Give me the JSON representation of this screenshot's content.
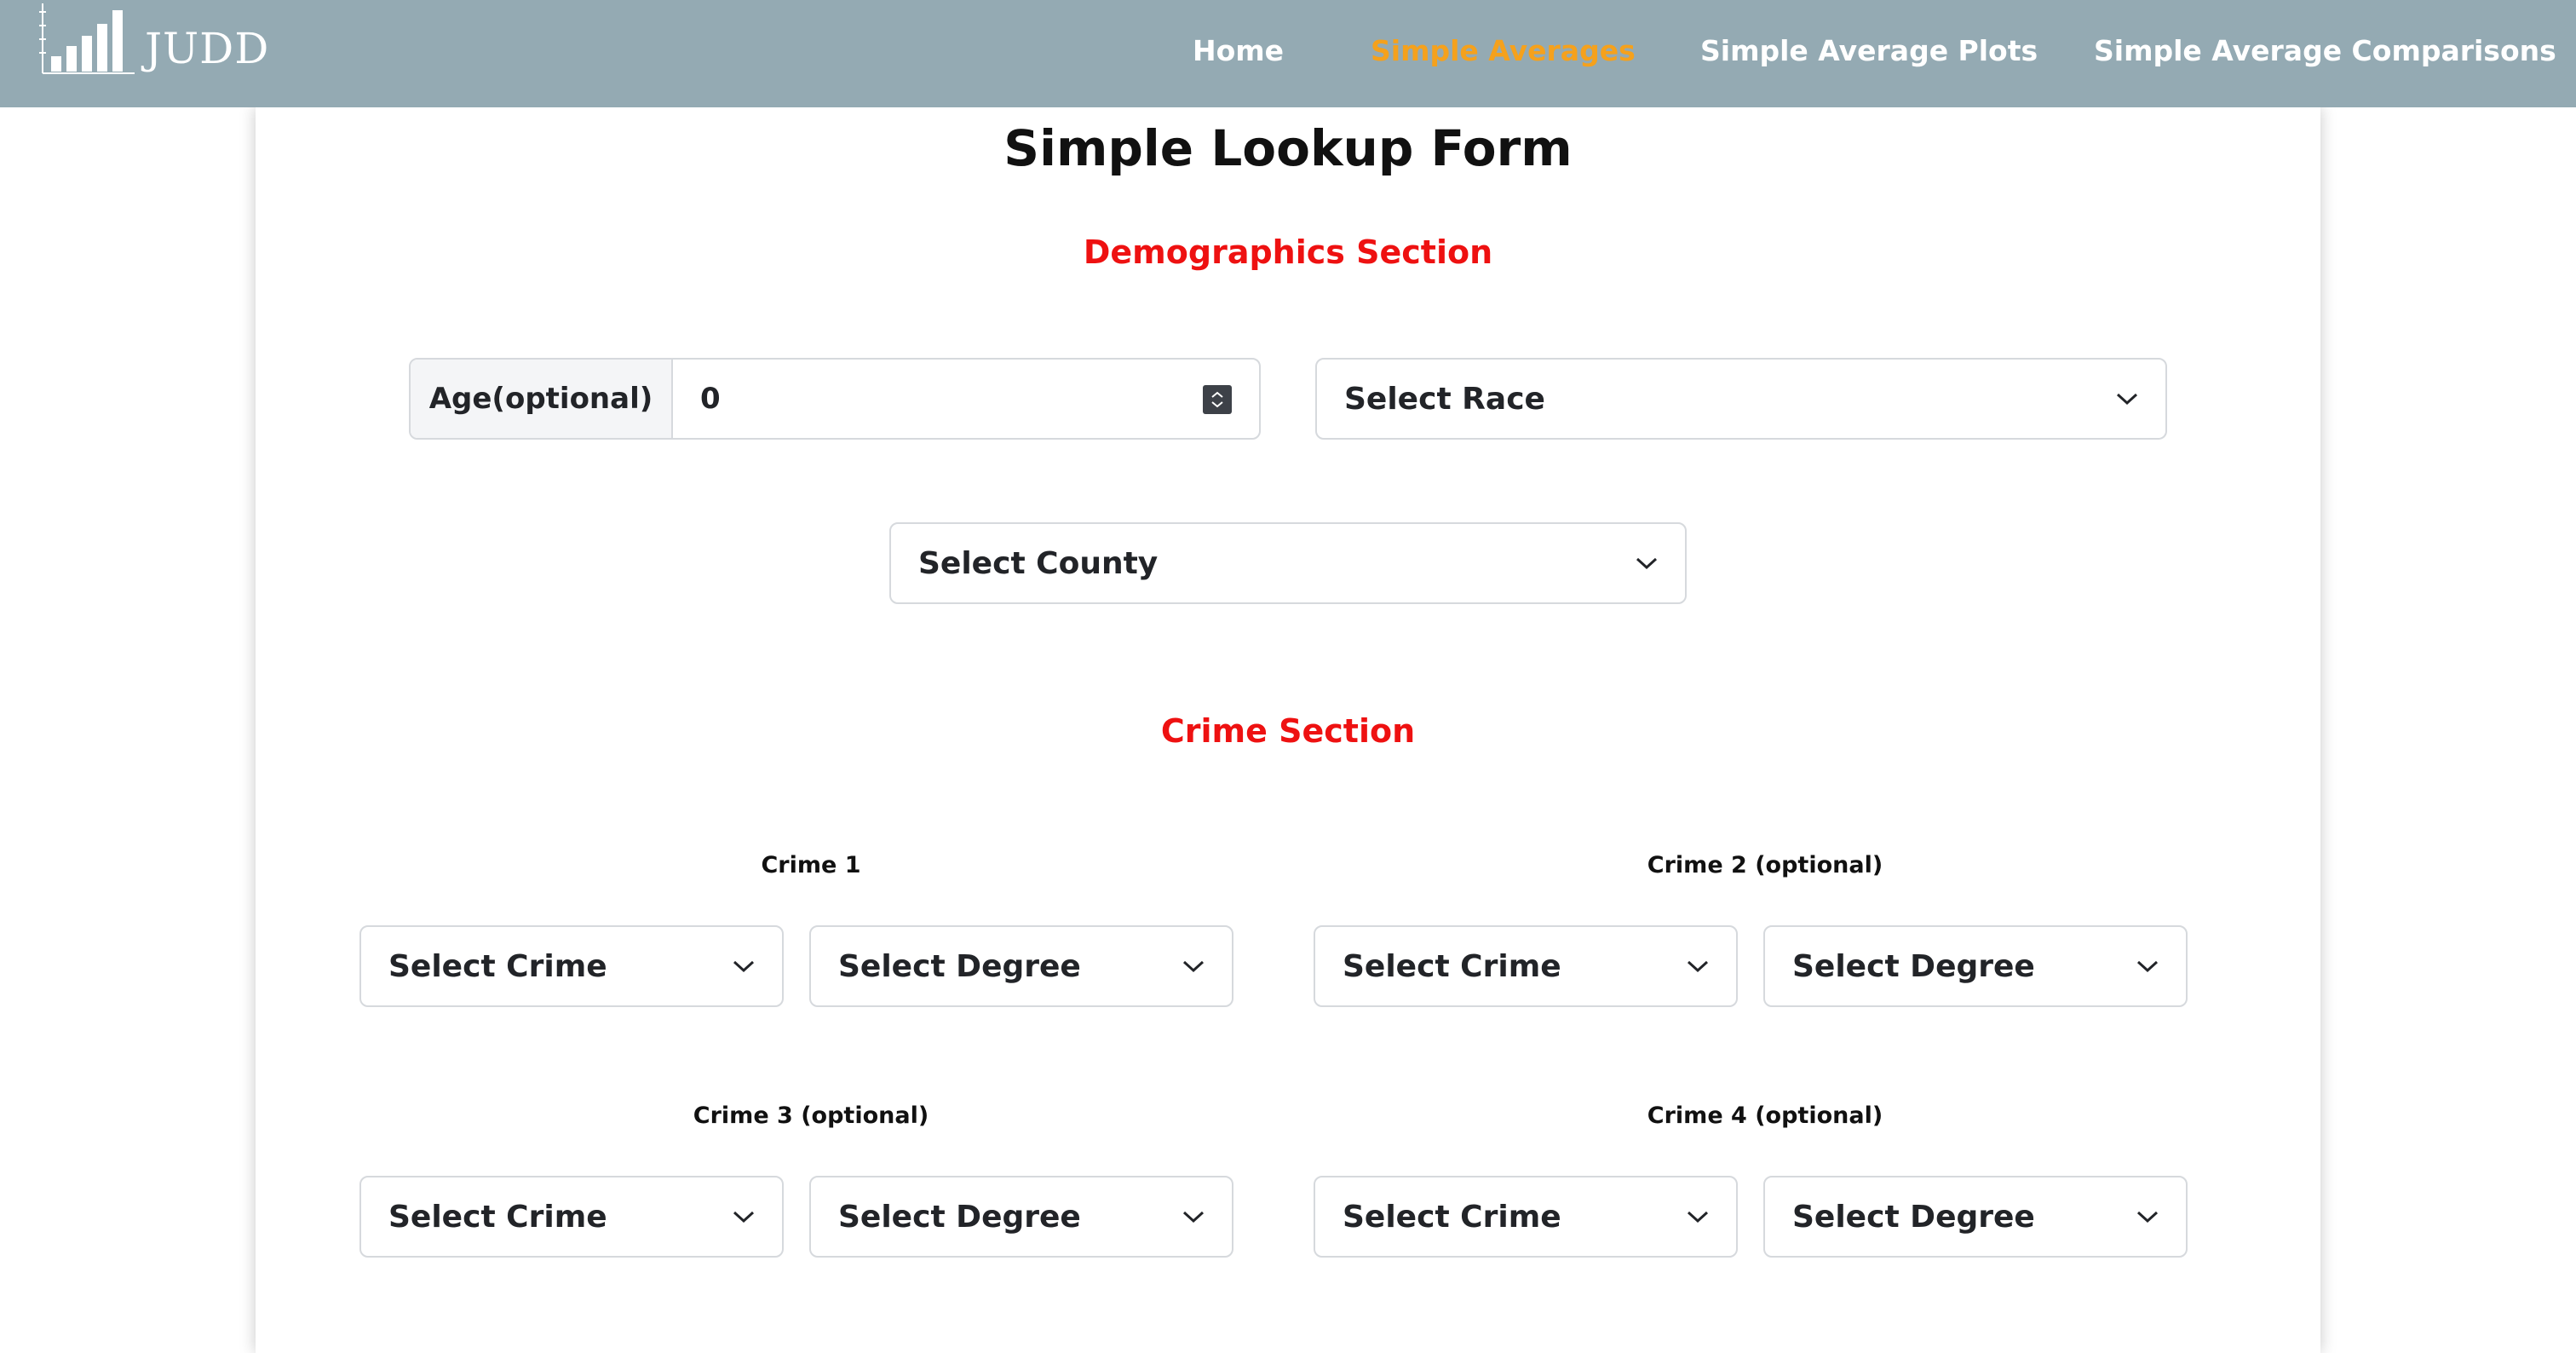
{
  "navbar": {
    "brand": "JUDD",
    "brand_icon": "bar-chart-logo-icon",
    "links": [
      {
        "label": "Home",
        "active": false
      },
      {
        "label": "Simple Averages",
        "active": true
      },
      {
        "label": "Simple Average Plots",
        "active": false
      },
      {
        "label": "Simple Average Comparisons",
        "active": false
      }
    ],
    "colors": {
      "background": "#94aab3",
      "active": "#f5a11c",
      "text": "#ffffff"
    }
  },
  "form": {
    "title": "Simple Lookup Form",
    "demographics": {
      "title": "Demographics Section",
      "age_label": "Age(optional)",
      "age_value": "0",
      "race_select": "Select Race",
      "county_select": "Select County"
    },
    "crime": {
      "title": "Crime Section",
      "crimes": [
        {
          "label": "Crime 1",
          "crime_select": "Select Crime",
          "degree_select": "Select Degree"
        },
        {
          "label": "Crime 2 (optional)",
          "crime_select": "Select Crime",
          "degree_select": "Select Degree"
        },
        {
          "label": "Crime 3 (optional)",
          "crime_select": "Select Crime",
          "degree_select": "Select Degree"
        },
        {
          "label": "Crime 4 (optional)",
          "crime_select": "Select Crime",
          "degree_select": "Select Degree"
        }
      ]
    },
    "colors": {
      "section_title": "#ee1111",
      "text": "#111111",
      "border": "#d6d9dd"
    }
  }
}
